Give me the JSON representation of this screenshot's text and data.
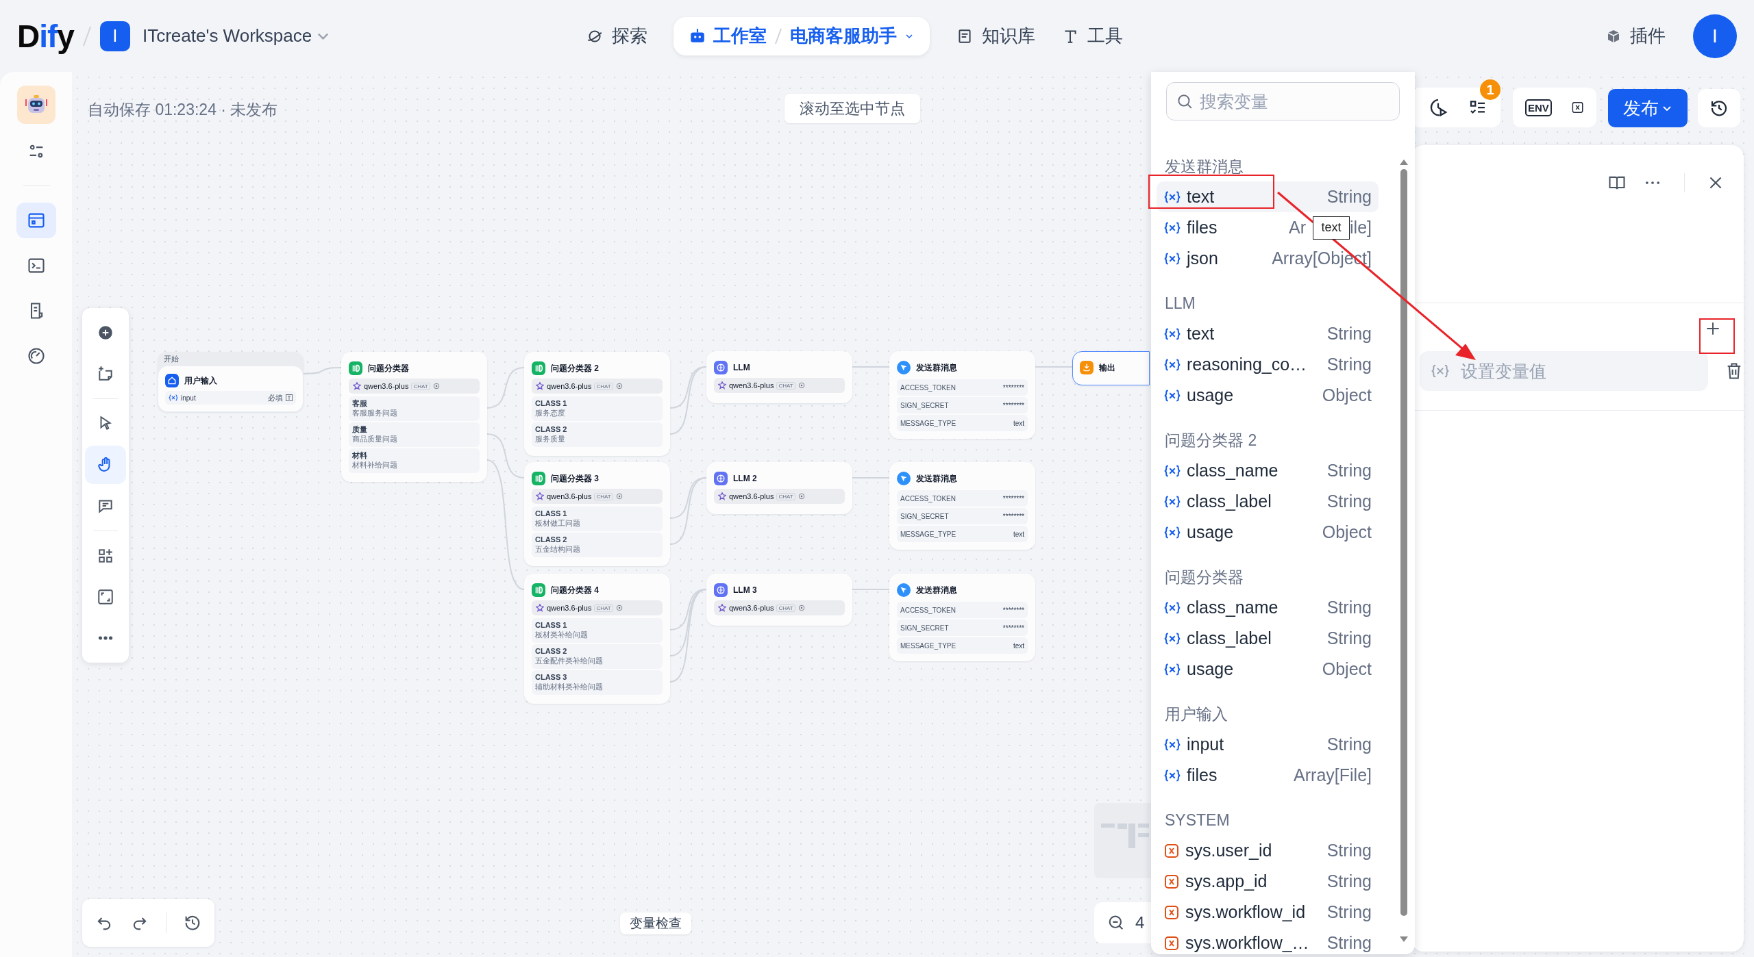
{
  "header": {
    "logo": "Dify",
    "workspace": {
      "initial": "I",
      "name": "ITcreate's Workspace"
    },
    "nav": [
      {
        "kind": "explore",
        "label": "探索",
        "selected": false
      },
      {
        "kind": "studio",
        "label": "工作室",
        "app": "电商客服助手",
        "selected": true
      },
      {
        "kind": "knowledge",
        "label": "知识库",
        "selected": false
      },
      {
        "kind": "tools",
        "label": "工具",
        "selected": false
      }
    ],
    "plugins": "插件",
    "avatar": "I"
  },
  "sidebar": [
    {
      "kind": "settings",
      "selected": false
    },
    {
      "kind": "orchestrate",
      "selected": true
    },
    {
      "kind": "api",
      "selected": false
    },
    {
      "kind": "logs",
      "selected": false
    },
    {
      "kind": "monitor",
      "selected": false
    }
  ],
  "autosave": "自动保存 01:23:24 · 未发布",
  "scroll_button": "滚动至选中节点",
  "palette": [
    {
      "kind": "add",
      "selected": false
    },
    {
      "kind": "note",
      "selected": false
    },
    {
      "kind": "pointer",
      "selected": false
    },
    {
      "kind": "hand",
      "selected": true
    },
    {
      "kind": "comment",
      "selected": false
    },
    {
      "kind": "layout",
      "selected": false
    },
    {
      "kind": "fit",
      "selected": false
    },
    {
      "kind": "more",
      "selected": false
    }
  ],
  "nodes": [
    {
      "kind": "start",
      "group": "开始",
      "title": "用户输入",
      "selected": false,
      "inputs": [
        {
          "name": "input",
          "required": "必填"
        }
      ]
    },
    {
      "kind": "classifier",
      "title": "问题分类器",
      "selected": false,
      "model": "qwen3.6-plus",
      "mode": "CHAT",
      "classes": [
        {
          "name": "客服",
          "desc": "客服服务问题"
        },
        {
          "name": "质量",
          "desc": "商品质量问题"
        },
        {
          "name": "材料",
          "desc": "材料补给问题"
        }
      ]
    },
    {
      "kind": "classifier",
      "title": "问题分类器 2",
      "selected": false,
      "model": "qwen3.6-plus",
      "mode": "CHAT",
      "classes": [
        {
          "name": "CLASS 1",
          "desc": "服务态度"
        },
        {
          "name": "CLASS 2",
          "desc": "服务质量"
        }
      ]
    },
    {
      "kind": "classifier",
      "title": "问题分类器 3",
      "selected": false,
      "model": "qwen3.6-plus",
      "mode": "CHAT",
      "classes": [
        {
          "name": "CLASS 1",
          "desc": "板材做工问题"
        },
        {
          "name": "CLASS 2",
          "desc": "五金结构问题"
        }
      ]
    },
    {
      "kind": "classifier",
      "title": "问题分类器 4",
      "selected": false,
      "model": "qwen3.6-plus",
      "mode": "CHAT",
      "classes": [
        {
          "name": "CLASS 1",
          "desc": "板材类补给问题"
        },
        {
          "name": "CLASS 2",
          "desc": "五金配件类补给问题"
        },
        {
          "name": "CLASS 3",
          "desc": "辅助材料类补给问题"
        }
      ]
    },
    {
      "kind": "llm",
      "title": "LLM",
      "selected": false,
      "model": "qwen3.6-plus",
      "mode": "CHAT"
    },
    {
      "kind": "llm",
      "title": "LLM 2",
      "selected": false,
      "model": "qwen3.6-plus",
      "mode": "CHAT"
    },
    {
      "kind": "llm",
      "title": "LLM 3",
      "selected": false,
      "model": "qwen3.6-plus",
      "mode": "CHAT"
    },
    {
      "kind": "send",
      "title": "发送群消息",
      "selected": false,
      "params": [
        {
          "name": "ACCESS_TOKEN",
          "value": "********"
        },
        {
          "name": "SIGN_SECRET",
          "value": "********"
        },
        {
          "name": "MESSAGE_TYPE",
          "value": "text"
        }
      ]
    },
    {
      "kind": "send",
      "title": "发送群消息",
      "selected": false,
      "params": [
        {
          "name": "ACCESS_TOKEN",
          "value": "********"
        },
        {
          "name": "SIGN_SECRET",
          "value": "********"
        },
        {
          "name": "MESSAGE_TYPE",
          "value": "text"
        }
      ]
    },
    {
      "kind": "send",
      "title": "发送群消息",
      "selected": false,
      "params": [
        {
          "name": "ACCESS_TOKEN",
          "value": "********"
        },
        {
          "name": "SIGN_SECRET",
          "value": "********"
        },
        {
          "name": "MESSAGE_TYPE",
          "value": "text"
        }
      ]
    },
    {
      "kind": "output",
      "title": "输出",
      "selected": true
    }
  ],
  "toolbar": {
    "checklist_badge": "1",
    "env": "ENV",
    "publish": "发布"
  },
  "variable_picker": {
    "placeholder": "搜索变量",
    "groups": [
      {
        "title": "发送群消息",
        "items": [
          {
            "kind": "var",
            "name": "text",
            "type": "String",
            "selected": true
          },
          {
            "kind": "var",
            "name": "files",
            "type": "Ar",
            "type_tail": "ile]",
            "selected": false
          },
          {
            "kind": "var",
            "name": "json",
            "type": "Array[Object]",
            "selected": false
          }
        ]
      },
      {
        "title": "LLM",
        "items": [
          {
            "kind": "var",
            "name": "text",
            "type": "String",
            "selected": false
          },
          {
            "kind": "var",
            "name": "reasoning_co…",
            "type": "String",
            "selected": false
          },
          {
            "kind": "var",
            "name": "usage",
            "type": "Object",
            "selected": false
          }
        ]
      },
      {
        "title": "问题分类器 2",
        "items": [
          {
            "kind": "var",
            "name": "class_name",
            "type": "String",
            "selected": false
          },
          {
            "kind": "var",
            "name": "class_label",
            "type": "String",
            "selected": false
          },
          {
            "kind": "var",
            "name": "usage",
            "type": "Object",
            "selected": false
          }
        ]
      },
      {
        "title": "问题分类器",
        "items": [
          {
            "kind": "var",
            "name": "class_name",
            "type": "String",
            "selected": false
          },
          {
            "kind": "var",
            "name": "class_label",
            "type": "String",
            "selected": false
          },
          {
            "kind": "var",
            "name": "usage",
            "type": "Object",
            "selected": false
          }
        ]
      },
      {
        "title": "用户输入",
        "items": [
          {
            "kind": "var",
            "name": "input",
            "type": "String",
            "selected": false
          },
          {
            "kind": "var",
            "name": "files",
            "type": "Array[File]",
            "selected": false
          }
        ]
      },
      {
        "title": "SYSTEM",
        "items": [
          {
            "kind": "sys",
            "name": "sys.user_id",
            "type": "String",
            "selected": false
          },
          {
            "kind": "sys",
            "name": "sys.app_id",
            "type": "String",
            "selected": false
          },
          {
            "kind": "sys",
            "name": "sys.workflow_id",
            "type": "String",
            "selected": false
          },
          {
            "kind": "sys",
            "name": "sys.workflow_…",
            "type": "String",
            "selected": false
          }
        ]
      }
    ]
  },
  "tooltip": "text",
  "panel": {
    "value_placeholder": "设置变量值"
  },
  "variable_inspect": "变量检查",
  "zoom_level": "4"
}
